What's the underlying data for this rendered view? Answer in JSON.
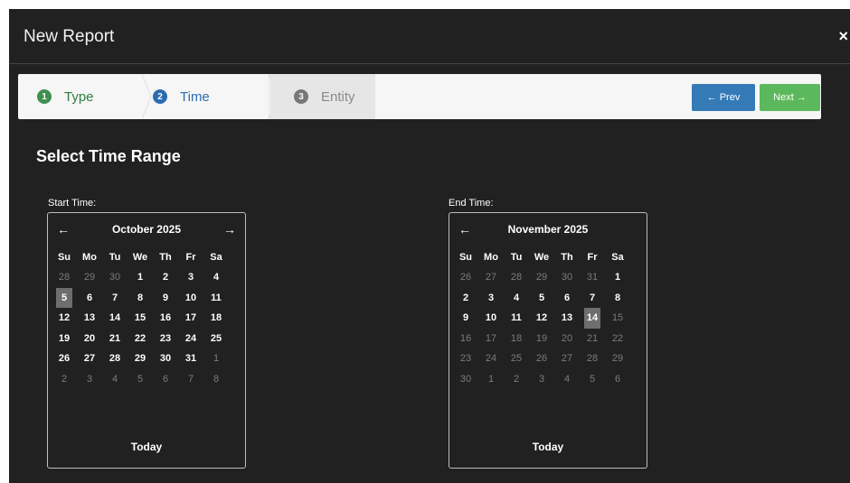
{
  "modal": {
    "title": "New Report",
    "close": "×"
  },
  "wizard": {
    "steps": [
      {
        "num": "1",
        "label": "Type"
      },
      {
        "num": "2",
        "label": "Time"
      },
      {
        "num": "3",
        "label": "Entity"
      }
    ],
    "prev_label": "← Prev",
    "next_label": "Next →"
  },
  "section_title": "Select Time Range",
  "start": {
    "label": "Start Time:",
    "month": "October 2025",
    "prev_arrow": "←",
    "next_arrow": "→",
    "dows": [
      "Su",
      "Mo",
      "Tu",
      "We",
      "Th",
      "Fr",
      "Sa"
    ],
    "days": [
      [
        "28",
        "29",
        "30",
        "1",
        "2",
        "3",
        "4"
      ],
      [
        "5",
        "6",
        "7",
        "8",
        "9",
        "10",
        "11"
      ],
      [
        "12",
        "13",
        "14",
        "15",
        "16",
        "17",
        "18"
      ],
      [
        "19",
        "20",
        "21",
        "22",
        "23",
        "24",
        "25"
      ],
      [
        "26",
        "27",
        "28",
        "29",
        "30",
        "31",
        "1"
      ],
      [
        "2",
        "3",
        "4",
        "5",
        "6",
        "7",
        "8"
      ]
    ],
    "muted": [
      [
        0,
        0
      ],
      [
        0,
        1
      ],
      [
        0,
        2
      ],
      [
        4,
        6
      ],
      [
        5,
        0
      ],
      [
        5,
        1
      ],
      [
        5,
        2
      ],
      [
        5,
        3
      ],
      [
        5,
        4
      ],
      [
        5,
        5
      ],
      [
        5,
        6
      ]
    ],
    "selected": [
      1,
      0
    ],
    "today": "Today"
  },
  "end": {
    "label": "End Time:",
    "month": "November 2025",
    "prev_arrow": "←",
    "next_arrow": "",
    "dows": [
      "Su",
      "Mo",
      "Tu",
      "We",
      "Th",
      "Fr",
      "Sa"
    ],
    "days": [
      [
        "26",
        "27",
        "28",
        "29",
        "30",
        "31",
        "1"
      ],
      [
        "2",
        "3",
        "4",
        "5",
        "6",
        "7",
        "8"
      ],
      [
        "9",
        "10",
        "11",
        "12",
        "13",
        "14",
        "15"
      ],
      [
        "16",
        "17",
        "18",
        "19",
        "20",
        "21",
        "22"
      ],
      [
        "23",
        "24",
        "25",
        "26",
        "27",
        "28",
        "29"
      ],
      [
        "30",
        "1",
        "2",
        "3",
        "4",
        "5",
        "6"
      ]
    ],
    "muted": [
      [
        0,
        0
      ],
      [
        0,
        1
      ],
      [
        0,
        2
      ],
      [
        0,
        3
      ],
      [
        0,
        4
      ],
      [
        0,
        5
      ],
      [
        2,
        6
      ],
      [
        3,
        0
      ],
      [
        3,
        1
      ],
      [
        3,
        2
      ],
      [
        3,
        3
      ],
      [
        3,
        4
      ],
      [
        3,
        5
      ],
      [
        3,
        6
      ],
      [
        4,
        0
      ],
      [
        4,
        1
      ],
      [
        4,
        2
      ],
      [
        4,
        3
      ],
      [
        4,
        4
      ],
      [
        4,
        5
      ],
      [
        4,
        6
      ],
      [
        5,
        0
      ],
      [
        5,
        1
      ],
      [
        5,
        2
      ],
      [
        5,
        3
      ],
      [
        5,
        4
      ],
      [
        5,
        5
      ],
      [
        5,
        6
      ]
    ],
    "selected": [
      2,
      5
    ],
    "today": "Today"
  }
}
